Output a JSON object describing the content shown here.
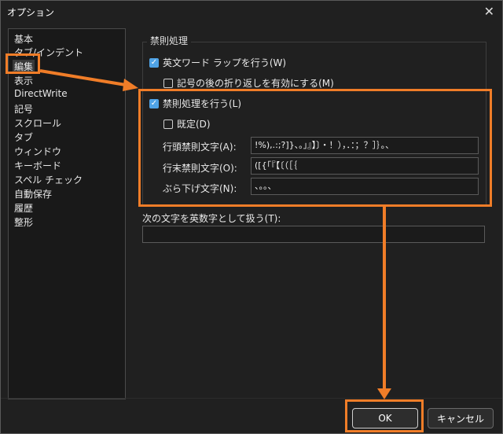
{
  "window": {
    "title": "オプション"
  },
  "sidebar": {
    "items": [
      {
        "label": "基本"
      },
      {
        "label": "タブ/インデント"
      },
      {
        "label": "編集"
      },
      {
        "label": "表示"
      },
      {
        "label": "DirectWrite"
      },
      {
        "label": "記号"
      },
      {
        "label": "スクロール"
      },
      {
        "label": "タブ"
      },
      {
        "label": "ウィンドウ"
      },
      {
        "label": "キーボード"
      },
      {
        "label": "スペル チェック"
      },
      {
        "label": "自動保存"
      },
      {
        "label": "履歴"
      },
      {
        "label": "整形"
      }
    ],
    "selected": "編集"
  },
  "main": {
    "group_title": "禁則処理",
    "english_wordwrap": {
      "label": "英文ワード ラップを行う(W)",
      "checked": true
    },
    "symbol_wrap": {
      "label": "記号の後の折り返しを有効にする(M)",
      "checked": false
    },
    "kinsoku": {
      "label": "禁則処理を行う(L)",
      "checked": true
    },
    "default": {
      "label": "既定(D)",
      "checked": false
    },
    "line_start": {
      "label": "行頭禁則文字(A):",
      "value": "!%),.:;?]}、。」』】〕・！），．：；？］｝。、"
    },
    "line_end": {
      "label": "行末禁則文字(O):",
      "value": "([{「『【〔（［｛"
    },
    "hanging": {
      "label": "ぶら下げ文字(N):",
      "value": "、。。、"
    },
    "alnum": {
      "label": "次の文字を英数字として扱う(T):",
      "value": ""
    }
  },
  "footer": {
    "ok": "OK",
    "cancel": "キャンセル"
  },
  "colors": {
    "highlight": "#f07d28",
    "checkbox": "#4fa3e6"
  }
}
